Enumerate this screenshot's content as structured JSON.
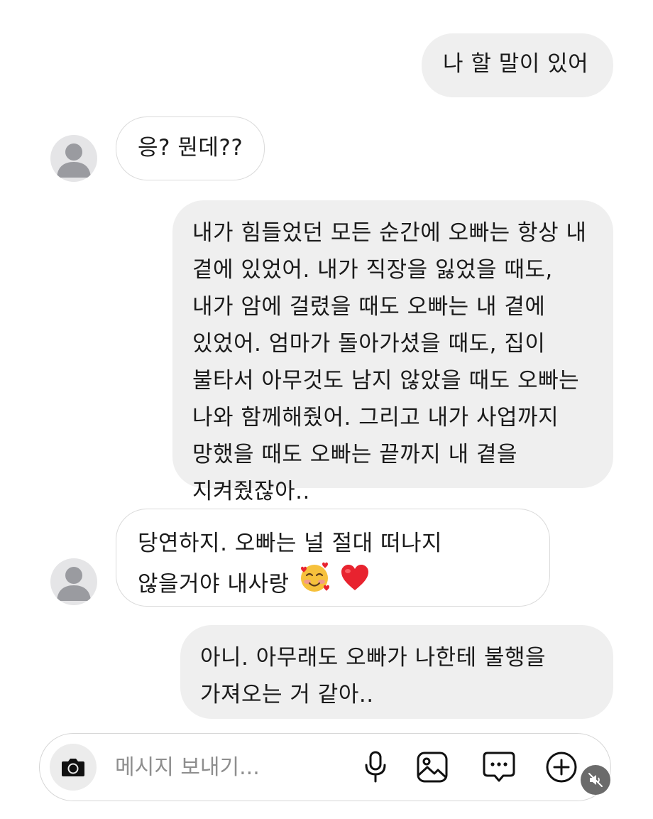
{
  "conversation": {
    "messages": [
      {
        "sender": "me",
        "text": "나 할 말이 있어"
      },
      {
        "sender": "other",
        "text": "응? 뭔데??"
      },
      {
        "sender": "me",
        "text": "내가 힘들었던 모든 순간에 오빠는 항상 내 곁에 있었어. 내가 직장을 잃었을 때도, 내가 암에 걸렸을 때도 오빠는 내 곁에 있었어. 엄마가 돌아가셨을 때도, 집이 불타서 아무것도 남지 않았을 때도 오빠는 나와 함께해줬어. 그리고 내가 사업까지 망했을 때도 오빠는 끝까지 내 곁을 지켜줬잖아.."
      },
      {
        "sender": "other",
        "text": "당연하지. 오빠는 널 절대 떠나지 않을거야 내사랑",
        "emojis": [
          "smiling-face-with-hearts",
          "red-heart"
        ]
      },
      {
        "sender": "me",
        "text": "아니. 아무래도 오빠가 나한테 불행을 가져오는 거 같아.."
      }
    ]
  },
  "composer": {
    "placeholder": "메시지 보내기...",
    "value": "",
    "icons": [
      "camera-icon",
      "microphone-icon",
      "image-icon",
      "chat-bubble-icon",
      "add-circle-icon",
      "mute-icon"
    ]
  },
  "colors": {
    "outgoing_bubble": "#efefef",
    "incoming_bubble_border": "#dadada",
    "avatar_background": "#e5e5e7",
    "avatar_silhouette": "#9a9ba0",
    "placeholder_text": "#8e8e8e",
    "heart": "#e8232f"
  }
}
